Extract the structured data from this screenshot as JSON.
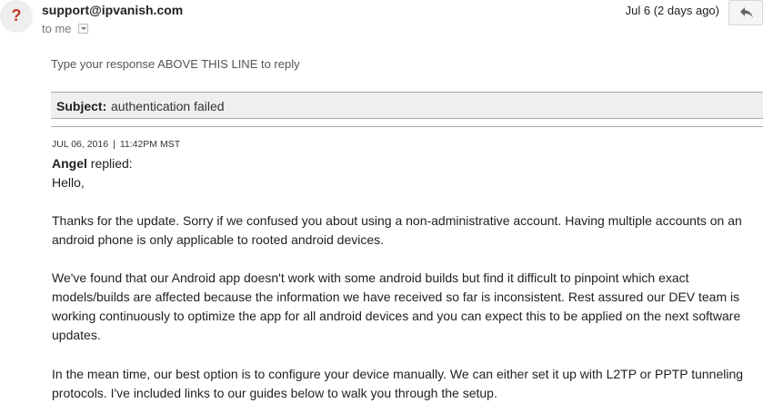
{
  "header": {
    "avatar_glyph": "?",
    "sender": "support@ipvanish.com",
    "recipient": "to me",
    "date": "Jul 6 (2 days ago)"
  },
  "message": {
    "response_hint": "Type your response ABOVE THIS LINE to reply",
    "subject_label": "Subject:",
    "subject_value": "authentication failed",
    "timestamp_date": "JUL 06, 2016",
    "timestamp_sep": "|",
    "timestamp_time": "11:42PM MST",
    "author": "Angel",
    "replied_text": "replied:",
    "greeting": "Hello,",
    "paragraphs": [
      "Thanks for the update. Sorry if we confused you about using a non-administrative account. Having multiple accounts on an android phone is only applicable to rooted android devices.",
      "We've found that our Android app doesn't work with some android builds but find it difficult to pinpoint which exact models/builds are affected because the information we have received so far is inconsistent. Rest assured our DEV team is working continuously to optimize the app for all android devices and you can expect this to be applied on the next software updates.",
      "In the mean time, our best option is to configure your device manually. We can either set it up with L2TP or PPTP tunneling protocols. I've included links to our guides below to walk you through the setup."
    ]
  },
  "icons": {
    "avatar": "unknown-sender-icon",
    "reply": "reply-arrow-icon",
    "recipient_details": "chevron-down-icon"
  },
  "colors": {
    "avatar_glyph": "#c0392b",
    "subject_bg": "#efefef"
  }
}
